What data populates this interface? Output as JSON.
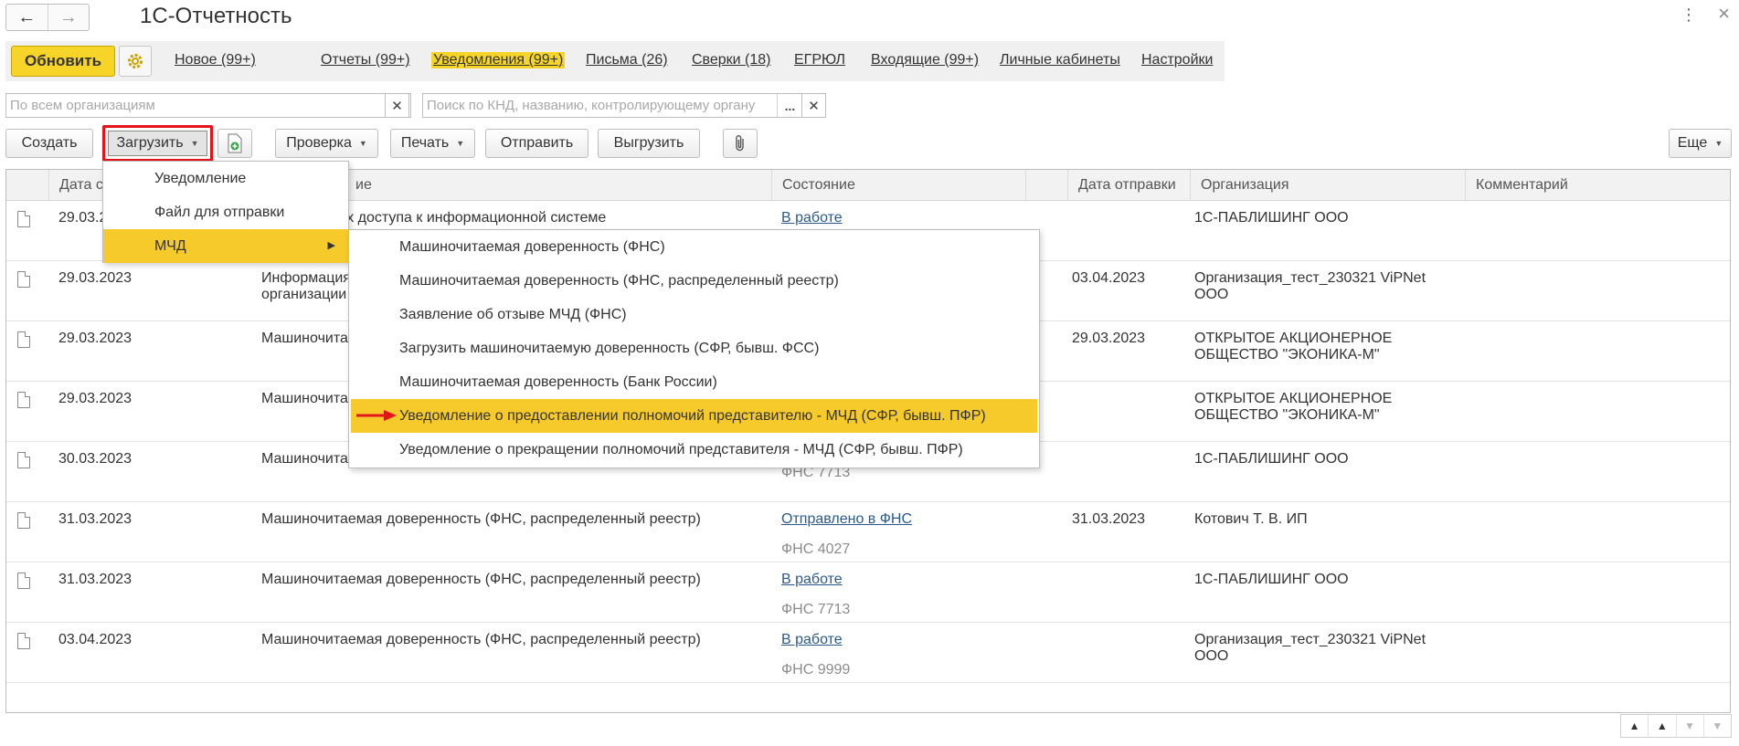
{
  "window": {
    "title": "1С-Отчетность",
    "back_icon": "arrow-left-icon",
    "forward_icon": "arrow-right-icon",
    "more_glyph": "⋮",
    "close_glyph": "×"
  },
  "sections": {
    "refresh_label": "Обновить",
    "items": [
      {
        "label": "Новое (99+)"
      },
      {
        "label": "Отчеты (99+)"
      },
      {
        "label": "Уведомления (99+)",
        "active": true
      },
      {
        "label": "Письма (26)"
      },
      {
        "label": "Сверки (18)"
      },
      {
        "label": "ЕГРЮЛ"
      },
      {
        "label": "Входящие (99+)"
      },
      {
        "label": "Личные кабинеты"
      },
      {
        "label": "Настройки"
      }
    ]
  },
  "filters": {
    "org_placeholder": "По всем организациям",
    "search_placeholder": "Поиск по КНД, названию, контролирующему органу",
    "dots": "..."
  },
  "toolbar": {
    "create": "Создать",
    "load": "Загрузить",
    "check": "Проверка",
    "print": "Печать",
    "send": "Отправить",
    "export": "Выгрузить",
    "more": "Еще"
  },
  "table": {
    "columns": [
      "Дата со",
      "ие",
      "Состояние",
      "Дата отправки",
      "Организация",
      "Комментарий"
    ],
    "rows": [
      {
        "date": "29.03.2",
        "name": "о параметрах доступа к информационной системе",
        "name2": "",
        "state": "В работе",
        "state_sub": "",
        "sent": "",
        "org": "1С-ПАБЛИШИНГ ООО",
        "org2": ""
      },
      {
        "date": "29.03.2023",
        "name": "Информация",
        "name2": "организации",
        "state": "",
        "state_sub": "",
        "sent": "03.04.2023",
        "org": "Организация_тест_230321 ViPNet",
        "org2": "ООО"
      },
      {
        "date": "29.03.2023",
        "name": "Машиночитае",
        "name2": "",
        "state": "",
        "state_sub": "",
        "sent": "29.03.2023",
        "org": "ОТКРЫТОЕ АКЦИОНЕРНОЕ",
        "org2": "ОБЩЕСТВО \"ЭКОНИКА-М\""
      },
      {
        "date": "29.03.2023",
        "name": "Машиночитае",
        "name2": "",
        "state": "",
        "state_sub": "",
        "sent": "",
        "org": "ОТКРЫТОЕ АКЦИОНЕРНОЕ",
        "org2": "ОБЩЕСТВО \"ЭКОНИКА-М\""
      },
      {
        "date": "30.03.2023",
        "name": "Машиночитае",
        "name2": "",
        "state": "",
        "state_sub": "ФНС 7713",
        "sent": "",
        "org": "1С-ПАБЛИШИНГ ООО",
        "org2": ""
      },
      {
        "date": "31.03.2023",
        "name": "Машиночитаемая доверенность (ФНС, распределенный реестр)",
        "name2": "",
        "state": "Отправлено в ФНС",
        "state_sub": "ФНС 4027",
        "sent": "31.03.2023",
        "org": "Котович Т. В. ИП",
        "org2": ""
      },
      {
        "date": "31.03.2023",
        "name": "Машиночитаемая доверенность (ФНС, распределенный реестр)",
        "name2": "",
        "state": "В работе",
        "state_sub": "ФНС 7713",
        "sent": "",
        "org": "1С-ПАБЛИШИНГ ООО",
        "org2": ""
      },
      {
        "date": "03.04.2023",
        "name": "Машиночитаемая доверенность (ФНС, распределенный реестр)",
        "name2": "",
        "state": "В работе",
        "state_sub": "ФНС 9999",
        "sent": "",
        "org": "Организация_тест_230321 ViPNet",
        "org2": "ООО"
      }
    ]
  },
  "menu_load": {
    "items": [
      "Уведомление",
      "Файл для отправки",
      "МЧД"
    ],
    "selected": "МЧД"
  },
  "menu_mchd": {
    "items": [
      "Машиночитаемая доверенность (ФНС)",
      "Машиночитаемая доверенность (ФНС, распределенный реестр)",
      "Заявление об отзыве МЧД (ФНС)",
      "Загрузить машиночитаемую доверенность (СФР, бывш. ФСС)",
      "Машиночитаемая доверенность (Банк России)",
      "Уведомление о предоставлении полномочий представителю - МЧД (СФР, бывш. ПФР)",
      "Уведомление о прекращении полномочий представителя - МЧД (СФР, бывш. ПФР)"
    ],
    "selected_index": 5
  },
  "colors": {
    "accent_yellow": "#f7d528",
    "highlight_yellow": "#f7ca2b",
    "annotation_red": "#e3141a",
    "link_blue": "#2b5a8a"
  }
}
